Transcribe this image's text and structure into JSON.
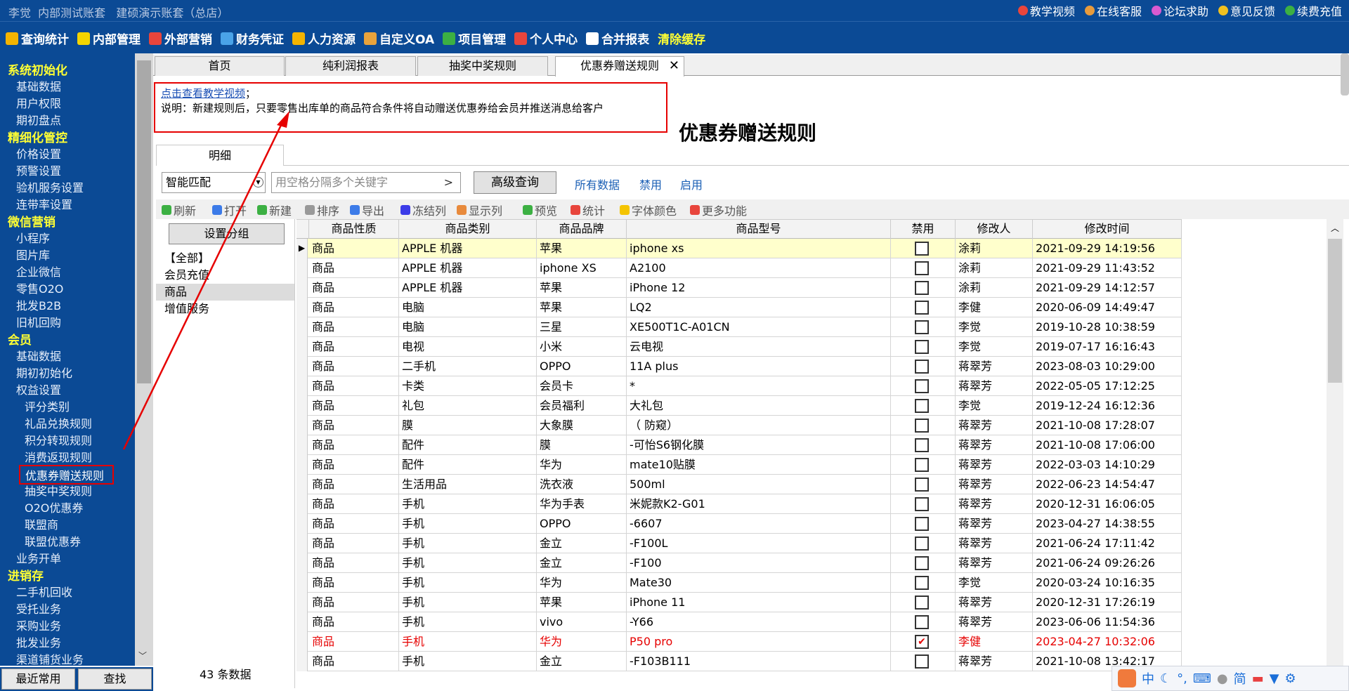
{
  "account": "李觉  内部测试账套   建硕演示账套（总店）",
  "top_links": [
    {
      "label": "教学视频",
      "icon": "video-icon",
      "color": "#e8453c"
    },
    {
      "label": "在线客服",
      "icon": "service-icon",
      "color": "#e89b3c"
    },
    {
      "label": "论坛求助",
      "icon": "forum-icon",
      "color": "#d85ad0"
    },
    {
      "label": "意见反馈",
      "icon": "pencil-icon",
      "color": "#f0c020"
    },
    {
      "label": "续费充值",
      "icon": "wechat-icon",
      "color": "#3cb043"
    }
  ],
  "menu": [
    {
      "label": "查询统计",
      "icon": "chart-icon",
      "color": "#f4b400"
    },
    {
      "label": "内部管理",
      "icon": "pencil-icon",
      "color": "#f4d400"
    },
    {
      "label": "外部营销",
      "icon": "bag-icon",
      "color": "#e8453c"
    },
    {
      "label": "财务凭证",
      "icon": "document-icon",
      "color": "#4aa3e8"
    },
    {
      "label": "人力资源",
      "icon": "person-icon",
      "color": "#f4b400"
    },
    {
      "label": "自定义OA",
      "icon": "tools-icon",
      "color": "#e8a33c"
    },
    {
      "label": "项目管理",
      "icon": "project-icon",
      "color": "#3cb043"
    },
    {
      "label": "个人中心",
      "icon": "heart-icon",
      "color": "#e8453c"
    },
    {
      "label": "合并报表",
      "icon": "report-icon",
      "color": "#ffffff"
    },
    {
      "label": "清除缓存",
      "icon": "",
      "color": ""
    }
  ],
  "sidebar": [
    {
      "type": "h",
      "label": "系统初始化"
    },
    {
      "type": "i",
      "label": "基础数据"
    },
    {
      "type": "i",
      "label": "用户权限"
    },
    {
      "type": "i",
      "label": "期初盘点"
    },
    {
      "type": "h",
      "label": "精细化管控"
    },
    {
      "type": "i",
      "label": "价格设置"
    },
    {
      "type": "i",
      "label": "预警设置"
    },
    {
      "type": "i",
      "label": "验机服务设置"
    },
    {
      "type": "i",
      "label": "连带率设置"
    },
    {
      "type": "h",
      "label": "微信营销"
    },
    {
      "type": "i",
      "label": "小程序"
    },
    {
      "type": "i",
      "label": "图片库"
    },
    {
      "type": "i",
      "label": "企业微信"
    },
    {
      "type": "i",
      "label": "零售O2O"
    },
    {
      "type": "i",
      "label": "批发B2B"
    },
    {
      "type": "i",
      "label": "旧机回购"
    },
    {
      "type": "h",
      "label": "会员"
    },
    {
      "type": "i",
      "label": "基础数据"
    },
    {
      "type": "i",
      "label": "期初初始化"
    },
    {
      "type": "i",
      "label": "权益设置"
    },
    {
      "type": "s",
      "label": "评分类别"
    },
    {
      "type": "s",
      "label": "礼品兑换规则"
    },
    {
      "type": "s",
      "label": "积分转现规则"
    },
    {
      "type": "s",
      "label": "消费返现规则"
    },
    {
      "type": "a",
      "label": "优惠券赠送规则"
    },
    {
      "type": "s",
      "label": "抽奖中奖规则"
    },
    {
      "type": "s",
      "label": "O2O优惠券"
    },
    {
      "type": "s",
      "label": "联盟商"
    },
    {
      "type": "s",
      "label": "联盟优惠券"
    },
    {
      "type": "i",
      "label": "业务开单"
    },
    {
      "type": "h",
      "label": "进销存"
    },
    {
      "type": "i",
      "label": "二手机回收"
    },
    {
      "type": "i",
      "label": "受托业务"
    },
    {
      "type": "i",
      "label": "采购业务"
    },
    {
      "type": "i",
      "label": "批发业务"
    },
    {
      "type": "i",
      "label": "渠道铺货业务"
    }
  ],
  "bottom_buttons": [
    "最近常用",
    "查找"
  ],
  "tabs": [
    {
      "label": "首页"
    },
    {
      "label": "纯利润报表"
    },
    {
      "label": "抽奖中奖规则"
    },
    {
      "label": "优惠券赠送规则",
      "close": "✕"
    }
  ],
  "note": {
    "link": "点击查看教学视频",
    "link_suffix": "；",
    "text": "说明：新建规则后，只要零售出库单的商品符合条件将自动赠送优惠券给会员并推送消息给客户"
  },
  "page_title": "优惠券赠送规则",
  "subtab": "明细",
  "search": {
    "match_value": "智能匹配",
    "keyword_placeholder": "用空格分隔多个关键字",
    "keyword_arrow": ">",
    "advanced_button": "高级查询",
    "filters": [
      "所有数据",
      "禁用",
      "启用"
    ]
  },
  "toolbar": [
    {
      "label": "刷新",
      "icon": "refresh-icon",
      "color": "#3cb043"
    },
    {
      "label": "打开",
      "icon": "open-icon",
      "color": "#3c7be8"
    },
    {
      "label": "新建",
      "icon": "plus-icon",
      "color": "#3cb043"
    },
    {
      "label": "排序",
      "icon": "sort-icon",
      "color": "#999999"
    },
    {
      "label": "导出",
      "icon": "export-icon",
      "color": "#3c7be8"
    },
    {
      "label": "冻结列",
      "icon": "freeze-icon",
      "color": "#3c3ce8"
    },
    {
      "label": "显示列",
      "icon": "columns-icon",
      "color": "#e88a3c"
    },
    {
      "label": "预览",
      "icon": "preview-icon",
      "color": "#3cb043"
    },
    {
      "label": "统计",
      "icon": "stats-icon",
      "color": "#e8453c"
    },
    {
      "label": "字体颜色",
      "icon": "font-color-icon",
      "color": "#f4c400"
    },
    {
      "label": "更多功能",
      "icon": "more-icon",
      "color": "#e8453c"
    }
  ],
  "groups": {
    "button": "设置分组",
    "items": [
      "【全部】",
      "会员充值",
      "商品",
      "增值服务"
    ],
    "selected": 2,
    "count_text": "43 条数据"
  },
  "grid": {
    "columns": [
      "商品性质",
      "商品类别",
      "商品品牌",
      "商品型号",
      "禁用",
      "修改人",
      "修改时间"
    ],
    "rows": [
      [
        "商品",
        "APPLE 机器",
        "苹果",
        "iphone xs",
        false,
        "涂莉",
        "2021-09-29 14:19:56"
      ],
      [
        "商品",
        "APPLE 机器",
        "iphone XS",
        "A2100",
        false,
        "涂莉",
        "2021-09-29 11:43:52"
      ],
      [
        "商品",
        "APPLE 机器",
        "苹果",
        "iPhone 12",
        false,
        "涂莉",
        "2021-09-29 14:12:57"
      ],
      [
        "商品",
        "电脑",
        "苹果",
        "LQ2",
        false,
        "李健",
        "2020-06-09 14:49:47"
      ],
      [
        "商品",
        "电脑",
        "三星",
        "XE500T1C-A01CN",
        false,
        "李觉",
        "2019-10-28 10:38:59"
      ],
      [
        "商品",
        "电视",
        "小米",
        "云电视",
        false,
        "李觉",
        "2019-07-17 16:16:43"
      ],
      [
        "商品",
        "二手机",
        "OPPO",
        "11A plus",
        false,
        "蒋翠芳",
        "2023-08-03 10:29:00"
      ],
      [
        "商品",
        "卡类",
        "会员卡",
        "*",
        false,
        "蒋翠芳",
        "2022-05-05 17:12:25"
      ],
      [
        "商品",
        "礼包",
        "会员福利",
        "大礼包",
        false,
        "李觉",
        "2019-12-24 16:12:36"
      ],
      [
        "商品",
        "膜",
        "大象膜",
        "（ 防窥）",
        false,
        "蒋翠芳",
        "2021-10-08 17:28:07"
      ],
      [
        "商品",
        "配件",
        "膜",
        "-可怡S6钢化膜",
        false,
        "蒋翠芳",
        "2021-10-08 17:06:00"
      ],
      [
        "商品",
        "配件",
        "华为",
        "mate10贴膜",
        false,
        "蒋翠芳",
        "2022-03-03 14:10:29"
      ],
      [
        "商品",
        "生活用品",
        "洗衣液",
        "500ml",
        false,
        "蒋翠芳",
        "2022-06-23 14:54:47"
      ],
      [
        "商品",
        "手机",
        "华为手表",
        "米妮款K2-G01",
        false,
        "蒋翠芳",
        "2020-12-31 16:06:05"
      ],
      [
        "商品",
        "手机",
        "OPPO",
        "-6607",
        false,
        "蒋翠芳",
        "2023-04-27 14:38:55"
      ],
      [
        "商品",
        "手机",
        "金立",
        "-F100L",
        false,
        "蒋翠芳",
        "2021-06-24 17:11:42"
      ],
      [
        "商品",
        "手机",
        "金立",
        "-F100",
        false,
        "蒋翠芳",
        "2021-06-24 09:26:26"
      ],
      [
        "商品",
        "手机",
        "华为",
        "Mate30",
        false,
        "李觉",
        "2020-03-24 10:16:35"
      ],
      [
        "商品",
        "手机",
        "苹果",
        "iPhone 11",
        false,
        "蒋翠芳",
        "2020-12-31 17:26:19"
      ],
      [
        "商品",
        "手机",
        "vivo",
        "-Y66",
        false,
        "蒋翠芳",
        "2023-06-06 11:54:36"
      ],
      [
        "商品",
        "手机",
        "华为",
        "P50 pro",
        true,
        "李健",
        "2023-04-27 10:32:06"
      ],
      [
        "商品",
        "手机",
        "金立",
        "-F103B111",
        false,
        "蒋翠芳",
        "2021-10-08 13:42:17"
      ]
    ],
    "highlight_row": 0,
    "current_row_marker": "▶"
  },
  "ime": [
    "中",
    "简"
  ]
}
